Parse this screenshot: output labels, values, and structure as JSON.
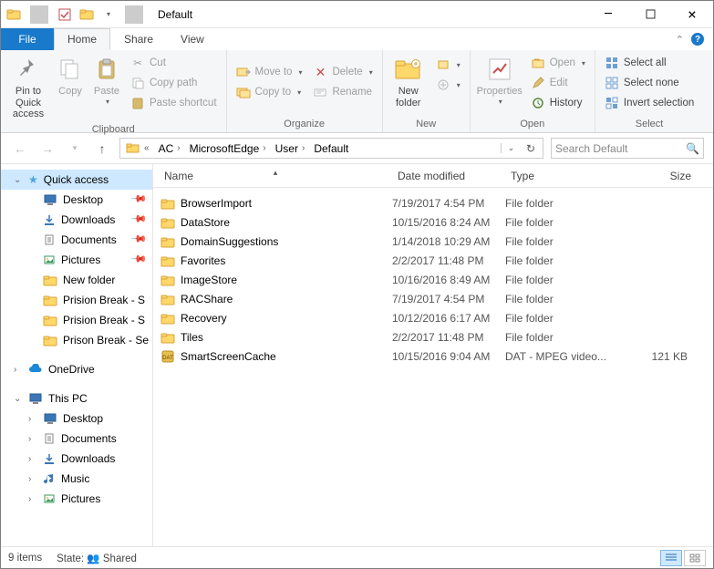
{
  "window": {
    "title": "Default"
  },
  "tabs": {
    "file": "File",
    "home": "Home",
    "share": "Share",
    "view": "View"
  },
  "ribbon": {
    "clipboard": {
      "label": "Clipboard",
      "pin": "Pin to Quick\naccess",
      "copy": "Copy",
      "paste": "Paste",
      "cut": "Cut",
      "copypath": "Copy path",
      "pasteshortcut": "Paste shortcut"
    },
    "organize": {
      "label": "Organize",
      "moveto": "Move to",
      "copyto": "Copy to",
      "delete": "Delete",
      "rename": "Rename"
    },
    "new": {
      "label": "New",
      "newfolder": "New\nfolder"
    },
    "open": {
      "label": "Open",
      "properties": "Properties",
      "open": "Open",
      "edit": "Edit",
      "history": "History"
    },
    "select": {
      "label": "Select",
      "all": "Select all",
      "none": "Select none",
      "invert": "Invert selection"
    }
  },
  "breadcrumb": [
    "AC",
    "MicrosoftEdge",
    "User",
    "Default"
  ],
  "search": {
    "placeholder": "Search Default"
  },
  "columns": {
    "name": "Name",
    "date": "Date modified",
    "type": "Type",
    "size": "Size"
  },
  "nav": {
    "quick": "Quick access",
    "quick_items": [
      "Desktop",
      "Downloads",
      "Documents",
      "Pictures",
      "New folder",
      "Prision Break - S",
      "Prision Break - S",
      "Prison Break - Se"
    ],
    "onedrive": "OneDrive",
    "thispc": "This PC",
    "pc_items": [
      "Desktop",
      "Documents",
      "Downloads",
      "Music",
      "Pictures"
    ]
  },
  "rows": [
    {
      "name": "BrowserImport",
      "date": "7/19/2017 4:54 PM",
      "type": "File folder",
      "size": "",
      "icon": "folder"
    },
    {
      "name": "DataStore",
      "date": "10/15/2016 8:24 AM",
      "type": "File folder",
      "size": "",
      "icon": "folder"
    },
    {
      "name": "DomainSuggestions",
      "date": "1/14/2018 10:29 AM",
      "type": "File folder",
      "size": "",
      "icon": "folder"
    },
    {
      "name": "Favorites",
      "date": "2/2/2017 11:48 PM",
      "type": "File folder",
      "size": "",
      "icon": "folder"
    },
    {
      "name": "ImageStore",
      "date": "10/16/2016 8:49 AM",
      "type": "File folder",
      "size": "",
      "icon": "folder"
    },
    {
      "name": "RACShare",
      "date": "7/19/2017 4:54 PM",
      "type": "File folder",
      "size": "",
      "icon": "folder"
    },
    {
      "name": "Recovery",
      "date": "10/12/2016 6:17 AM",
      "type": "File folder",
      "size": "",
      "icon": "folder"
    },
    {
      "name": "Tiles",
      "date": "2/2/2017 11:48 PM",
      "type": "File folder",
      "size": "",
      "icon": "folder"
    },
    {
      "name": "SmartScreenCache",
      "date": "10/15/2016 9:04 AM",
      "type": "DAT - MPEG video...",
      "size": "121 KB",
      "icon": "dat"
    }
  ],
  "status": {
    "count": "9 items",
    "state_label": "State:",
    "state_value": "Shared"
  }
}
